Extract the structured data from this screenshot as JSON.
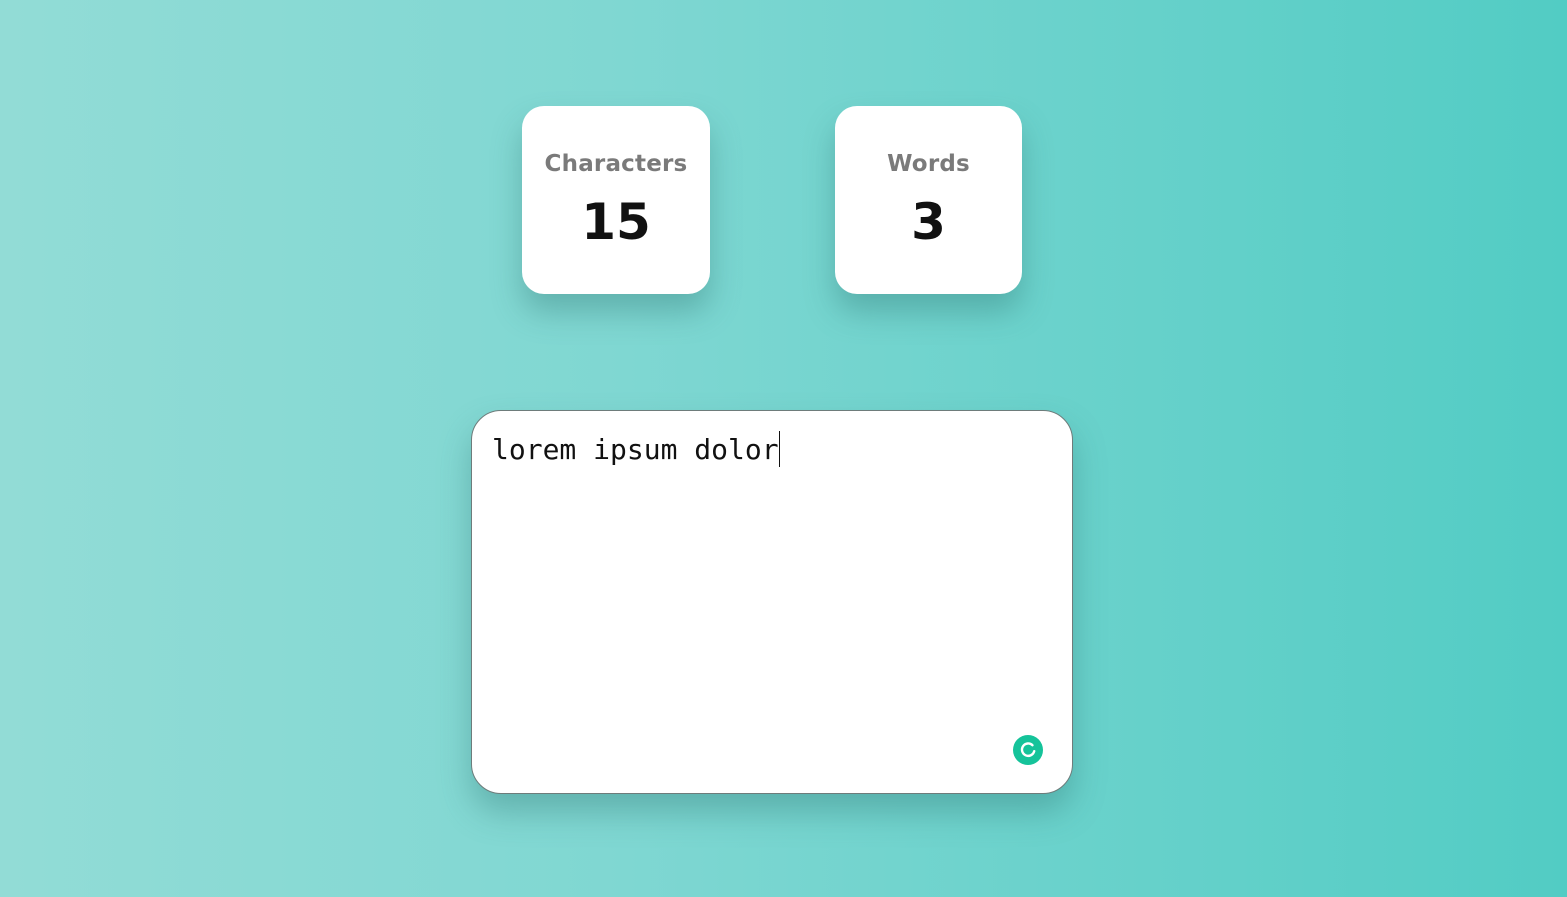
{
  "stats": {
    "characters": {
      "label": "Characters",
      "value": "15"
    },
    "words": {
      "label": "Words",
      "value": "3"
    }
  },
  "editor": {
    "text": "lorem ipsum dolor"
  },
  "assistant": {
    "icon": "grammarly-icon",
    "color": "#15c39a"
  },
  "colors": {
    "background_start": "#92dcd6",
    "background_end": "#52ccc4",
    "label": "#7a7a7a",
    "value": "#111111"
  }
}
